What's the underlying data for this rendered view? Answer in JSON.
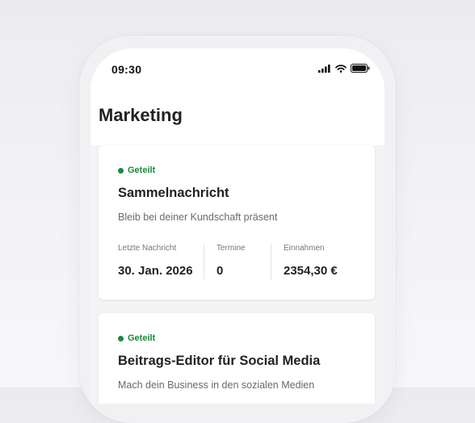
{
  "status_bar": {
    "time": "09:30",
    "icons": [
      "signal-icon",
      "wifi-icon",
      "battery-icon"
    ]
  },
  "page": {
    "title": "Marketing"
  },
  "cards": [
    {
      "badge": "Geteilt",
      "title": "Sammelnachricht",
      "subtitle": "Bleib bei deiner Kundschaft präsent",
      "stats": [
        {
          "label": "Letzte Nachricht",
          "value": "30. Jan. 2026"
        },
        {
          "label": "Termine",
          "value": "0"
        },
        {
          "label": "Einnahmen",
          "value": "2354,30 €"
        }
      ]
    },
    {
      "badge": "Geteilt",
      "title": "Beitrags-Editor für Social Media",
      "subtitle": "Mach dein Business in den sozialen Medien"
    }
  ],
  "colors": {
    "badge_green": "#178a3c",
    "screen_bg": "#f4f4f6",
    "card_bg": "#ffffff"
  }
}
